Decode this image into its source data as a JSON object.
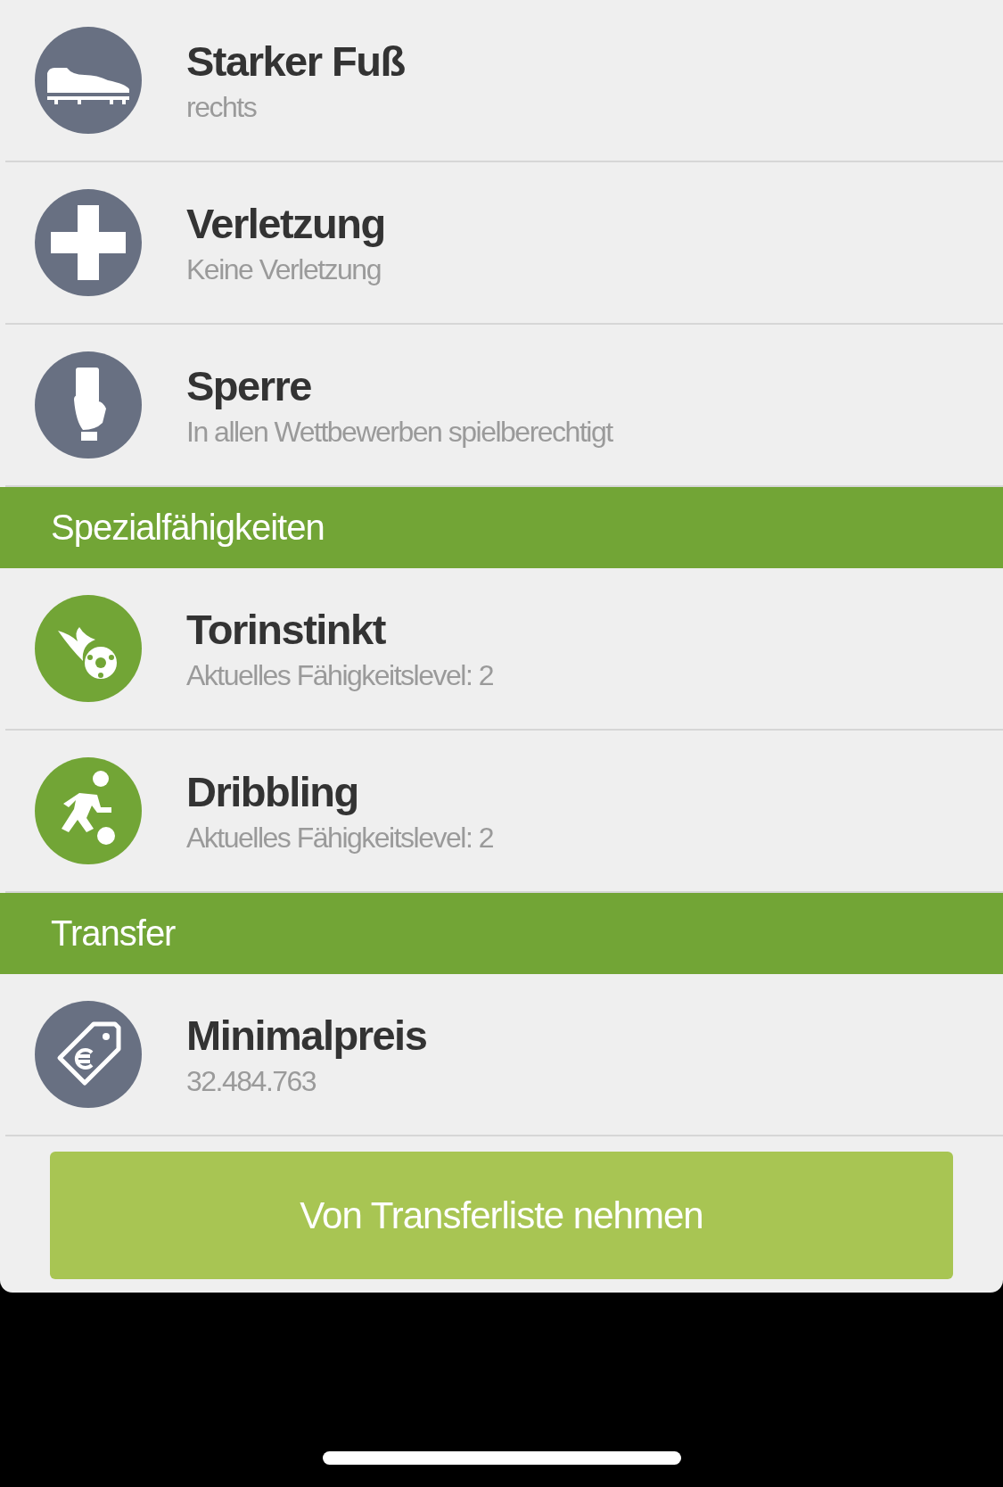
{
  "sections": [
    {
      "rows": [
        {
          "kind": "strong-foot",
          "title": "Starker Fuß",
          "value": "rechts"
        },
        {
          "kind": "injury",
          "title": "Verletzung",
          "value": "Keine Verletzung"
        },
        {
          "kind": "suspension",
          "title": "Sperre",
          "value": "In allen Wettbewerben spielberechtigt"
        }
      ]
    },
    {
      "header": "Spezialfähigkeiten",
      "rows": [
        {
          "kind": "goal-instinct",
          "title": "Torinstinkt",
          "value": "Aktuelles Fähigkeitslevel: 2"
        },
        {
          "kind": "dribbling",
          "title": "Dribbling",
          "value": "Aktuelles Fähigkeitslevel: 2"
        }
      ]
    },
    {
      "header": "Transfer",
      "rows": [
        {
          "kind": "price",
          "title": "Minimalpreis",
          "value": "32.484.763"
        }
      ]
    }
  ],
  "button": "Von Transferliste nehmen"
}
